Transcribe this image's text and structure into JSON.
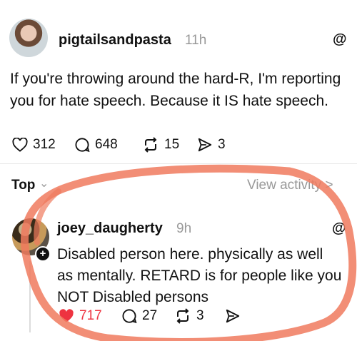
{
  "post": {
    "username": "pigtailsandpasta",
    "time": "11h",
    "text": "If you're throwing around the hard-R, I'm reporting you for hate speech. Because it IS hate speech.",
    "likes": "312",
    "replies": "648",
    "reposts": "15",
    "shares": "3"
  },
  "sort": {
    "label": "Top",
    "view_activity": "View activity >"
  },
  "reply": {
    "username": "joey_daugherty",
    "time": "9h",
    "text": "Disabled person here. physically as well as mentally. RETARD is for people like you NOT Disabled persons",
    "likes": "717",
    "replies": "27",
    "reposts": "3"
  },
  "icons": {
    "threads_logo": "@",
    "plus": "+",
    "chevron": "⌄"
  },
  "colors": {
    "liked_red": "#ee3340",
    "annotation_red": "#f07a5e"
  }
}
